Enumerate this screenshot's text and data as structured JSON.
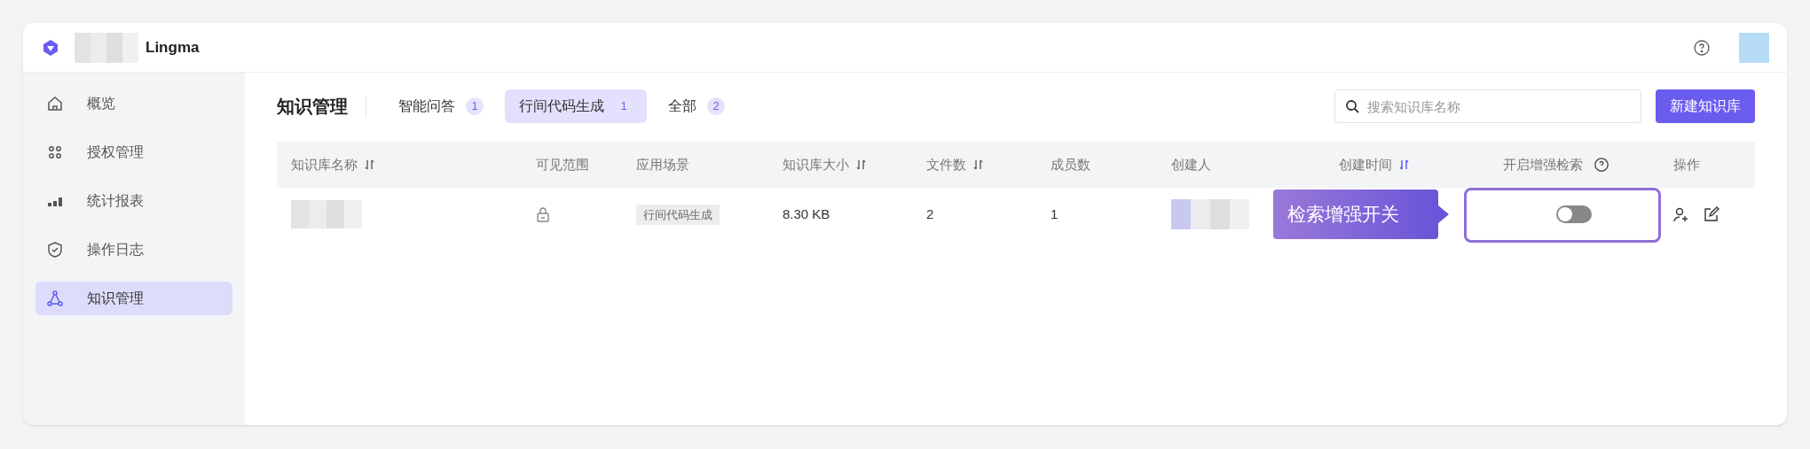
{
  "header": {
    "product": "Lingma"
  },
  "sidebar": {
    "items": [
      {
        "label": "概览",
        "selected": false
      },
      {
        "label": "授权管理",
        "selected": false
      },
      {
        "label": "统计报表",
        "selected": false
      },
      {
        "label": "操作日志",
        "selected": false
      },
      {
        "label": "知识管理",
        "selected": true
      }
    ]
  },
  "page_title": "知识管理",
  "tabs": [
    {
      "label": "智能问答",
      "count": "1",
      "selected": false
    },
    {
      "label": "行间代码生成",
      "count": "1",
      "selected": true
    },
    {
      "label": "全部",
      "count": "2",
      "selected": false
    }
  ],
  "search": {
    "placeholder": "搜索知识库名称"
  },
  "new_button": "新建知识库",
  "table": {
    "columns": [
      {
        "label": "知识库名称",
        "sortable": true,
        "sorted": false
      },
      {
        "label": "可见范围"
      },
      {
        "label": "应用场景"
      },
      {
        "label": "知识库大小",
        "sortable": true,
        "sorted": false
      },
      {
        "label": "文件数",
        "sortable": true,
        "sorted": false
      },
      {
        "label": "成员数"
      },
      {
        "label": "创建人"
      },
      {
        "label": "创建时间",
        "sortable": true,
        "sorted": true
      },
      {
        "label": "开启增强检索",
        "help": true
      },
      {
        "label": "操作"
      }
    ],
    "rows": [
      {
        "scenario": "行间代码生成",
        "size": "8.30 KB",
        "files": "2",
        "members": "1",
        "enhanced": false
      }
    ]
  },
  "callout": {
    "text": "检索增强开关"
  }
}
